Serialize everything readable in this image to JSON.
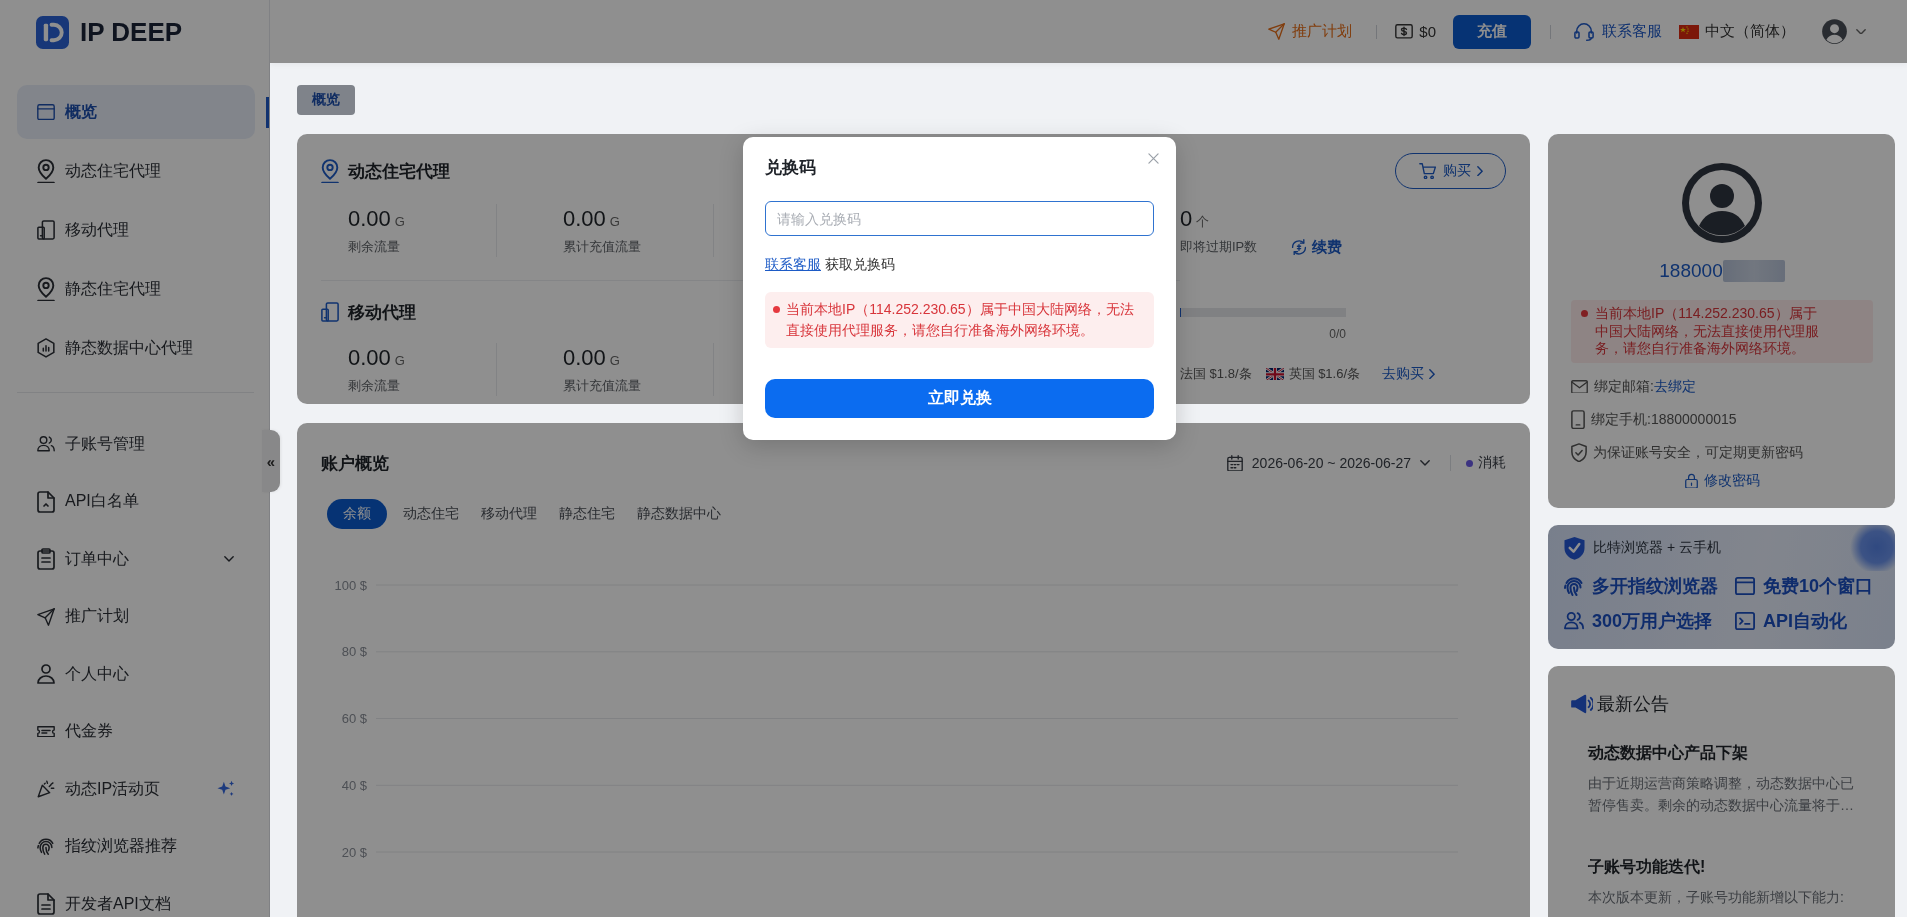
{
  "sidebar": {
    "logo": "IP DEEP",
    "groups": [
      {
        "items": [
          {
            "label": "概览",
            "kind": "link",
            "selected": true
          },
          {
            "label": "动态住宅代理",
            "kind": "link",
            "selected": false
          },
          {
            "label": "移动代理",
            "kind": "link",
            "selected": false
          },
          {
            "label": "静态住宅代理",
            "kind": "link",
            "selected": false
          },
          {
            "label": "静态数据中心代理",
            "kind": "link",
            "selected": false
          }
        ]
      },
      {
        "items": [
          {
            "label": "子账号管理",
            "kind": "link",
            "selected": false
          },
          {
            "label": "API白名单",
            "kind": "link",
            "selected": false
          },
          {
            "label": "订单中心",
            "kind": "submenu",
            "selected": false,
            "expanded": false
          },
          {
            "label": "推广计划",
            "kind": "link",
            "selected": false
          },
          {
            "label": "个人中心",
            "kind": "link",
            "selected": false
          },
          {
            "label": "代金券",
            "kind": "link",
            "selected": false
          },
          {
            "label": "动态IP活动页",
            "kind": "featured",
            "selected": false
          },
          {
            "label": "指纹浏览器推荐",
            "kind": "link",
            "selected": false
          },
          {
            "label": "开发者API文档",
            "kind": "link",
            "selected": false
          }
        ]
      }
    ],
    "collapse_button": "«"
  },
  "topbar": {
    "promo_link": "推广计划",
    "balance": "$0",
    "recharge_button": "充值",
    "support_link": "联系客服",
    "language": "中文（简体）"
  },
  "breadcrumb_tabs": [
    {
      "label": "概览",
      "selected": true
    }
  ],
  "proxy_summary": {
    "buy_button": "购买",
    "sections": [
      {
        "kind": "expiry",
        "title": "动态住宅代理",
        "stats": [
          {
            "value": "0.00",
            "unit": "G",
            "label": "剩余流量"
          },
          {
            "value": "0.00",
            "unit": "G",
            "label": "累计充值流量"
          }
        ],
        "ip_count": {
          "value": "0",
          "unit": "个",
          "label": "即将过期IP数"
        },
        "renew_link": "续费"
      },
      {
        "kind": "usage",
        "title": "移动代理",
        "stats": [
          {
            "value": "0.00",
            "unit": "G",
            "label": "剩余流量"
          },
          {
            "value": "0.00",
            "unit": "G",
            "label": "累计充值流量"
          }
        ],
        "usage": {
          "level": 0,
          "reading": "0/0"
        },
        "prices": [
          "法国 $1.8/条",
          "英国 $1.6/条"
        ],
        "buy_link": "去购买"
      }
    ]
  },
  "account_overview": {
    "title": "账户概览",
    "date_range": "2026-06-20 ~ 2026-06-27",
    "legend": [
      {
        "label": "消耗",
        "color": "#3c3381"
      }
    ],
    "tabs": [
      {
        "label": "余额",
        "selected": true
      },
      {
        "label": "动态住宅",
        "selected": false
      },
      {
        "label": "移动代理",
        "selected": false
      },
      {
        "label": "静态住宅",
        "selected": false
      },
      {
        "label": "静态数据中心",
        "selected": false
      }
    ],
    "chart_axis_labels": [
      "100 $",
      "80 $",
      "60 $",
      "40 $",
      "20 $"
    ]
  },
  "profile": {
    "phone_masked": "188000",
    "alert": "当前本地IP（114.252.230.65）属于中国大陆网络，无法直接使用代理服务，请您自行准备海外网络环境。",
    "details": [
      {
        "kind": "email",
        "label": "绑定邮箱:",
        "link": "去绑定"
      },
      {
        "kind": "phone",
        "label": "绑定手机:18800000015"
      },
      {
        "kind": "security",
        "label": "为保证账号安全，可定期更新密码"
      }
    ],
    "change_password_link": "修改密码"
  },
  "promo_banner": {
    "brand": "比特浏览器 + 云手机",
    "features": [
      "多开指纹浏览器",
      "免费10个窗口",
      "300万用户选择",
      "API自动化"
    ]
  },
  "announcements": {
    "title": "最新公告",
    "items": [
      {
        "title": "动态数据中心产品下架",
        "body": "由于近期运营商策略调整，动态数据中心已暂停售卖。剩余的动态数据中心流量将于…"
      },
      {
        "title": "子账号功能迭代!",
        "body": "本次版本更新，子账号功能新增以下能力:"
      }
    ]
  },
  "redeem_dialog": {
    "title": "兑换码",
    "placeholder": "请输入兑换码",
    "help_link": "联系客服",
    "help_text": "获取兑换码",
    "alert": "当前本地IP（114.252.230.65）属于中国大陆网络，无法直接使用代理服务，请您自行准备海外网络环境。",
    "submit_button": "立即兑换"
  }
}
